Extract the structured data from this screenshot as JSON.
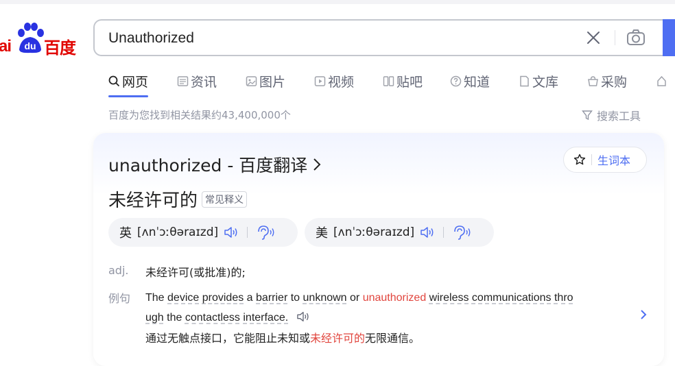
{
  "logo": {
    "text_left": "ai",
    "paw_text": "du",
    "text_cn": "百度"
  },
  "search": {
    "value": "Unauthorized"
  },
  "tabs": [
    {
      "label": "网页",
      "icon": "search-icon",
      "active": true
    },
    {
      "label": "资讯",
      "icon": "news-icon"
    },
    {
      "label": "图片",
      "icon": "image-icon"
    },
    {
      "label": "视频",
      "icon": "video-icon"
    },
    {
      "label": "贴吧",
      "icon": "tieba-icon"
    },
    {
      "label": "知道",
      "icon": "question-icon"
    },
    {
      "label": "文库",
      "icon": "document-icon"
    },
    {
      "label": "采购",
      "icon": "basket-icon"
    },
    {
      "label": "",
      "icon": "more-icon"
    }
  ],
  "result_count": "百度为您找到相关结果约43,400,000个",
  "search_tools": "搜索工具",
  "card": {
    "title": "unauthorized - 百度翻译",
    "vocab_label": "生词本",
    "meaning": "未经许可的",
    "meaning_tag": "常见释义",
    "uk": {
      "lang": "英",
      "phonetic": "[ʌnˈɔːθəraɪzd]"
    },
    "us": {
      "lang": "美",
      "phonetic": "[ʌnˈɔːθəraɪzd]"
    },
    "pos": "adj.",
    "definition": "未经许可(或批准)的;",
    "example_label": "例句",
    "example_en": {
      "w1": "The",
      "w2": "device",
      "w3": "provides",
      "w4": "a",
      "w5": "barrier",
      "w6": "to",
      "w7": "unknown",
      "w8": "or",
      "w9": "unauthorized",
      "w10": "wireless",
      "w11": "communications",
      "w12": "thro",
      "w13": "ugh",
      "w14": "the",
      "w15": "contactless",
      "w16": "interface."
    },
    "example_cn": {
      "pre": "通过无触点接口，它能阻止未知或",
      "highlight": "未经许可的",
      "post": "无限通信。"
    }
  },
  "colors": {
    "accent": "#4e6ef2",
    "brand": "#e10602",
    "highlight": "#e1453d"
  }
}
